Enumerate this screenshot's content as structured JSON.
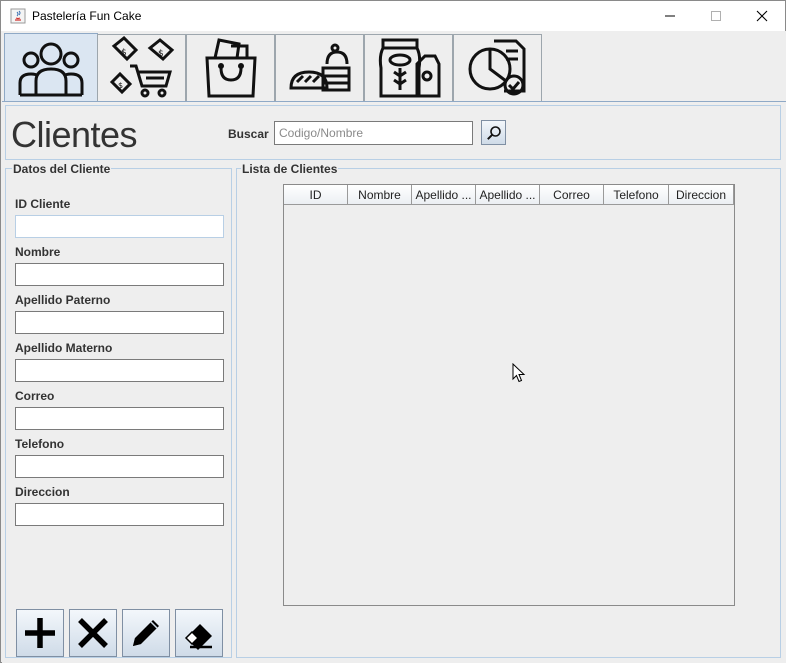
{
  "window": {
    "title": "Pastelería Fun Cake"
  },
  "tabs": [
    {
      "icon": "customers-icon",
      "active": true
    },
    {
      "icon": "sales-cart-icon",
      "active": false
    },
    {
      "icon": "shopping-bag-icon",
      "active": false
    },
    {
      "icon": "bakery-products-icon",
      "active": false
    },
    {
      "icon": "groceries-icon",
      "active": false
    },
    {
      "icon": "report-chart-icon",
      "active": false
    }
  ],
  "header": {
    "title": "Clientes",
    "search_label": "Buscar",
    "search_placeholder": "Codigo/Nombre",
    "search_value": ""
  },
  "form": {
    "group_title": "Datos del Cliente",
    "fields": [
      {
        "label": "ID Cliente",
        "value": ""
      },
      {
        "label": "Nombre",
        "value": ""
      },
      {
        "label": "Apellido Paterno",
        "value": ""
      },
      {
        "label": "Apellido Materno",
        "value": ""
      },
      {
        "label": "Correo",
        "value": ""
      },
      {
        "label": "Telefono",
        "value": ""
      },
      {
        "label": "Direccion",
        "value": ""
      }
    ],
    "actions": [
      {
        "icon": "plus-icon"
      },
      {
        "icon": "x-icon"
      },
      {
        "icon": "pencil-icon"
      },
      {
        "icon": "eraser-icon"
      }
    ]
  },
  "table": {
    "group_title": "Lista de Clientes",
    "columns": [
      "ID",
      "Nombre",
      "Apellido ...",
      "Apellido ...",
      "Correo",
      "Telefono",
      "Direccion"
    ],
    "rows": []
  },
  "colors": {
    "active_tab": "#dbe6f2",
    "panel_border": "#b8cfe5",
    "background": "#eeeeee"
  }
}
